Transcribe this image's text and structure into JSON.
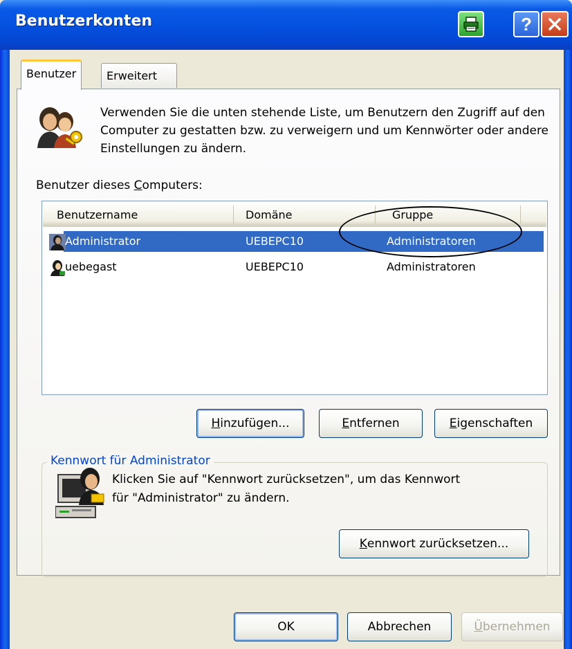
{
  "window": {
    "title": "Benutzerkonten",
    "icons": {
      "print": "printer-icon",
      "help": "help-icon",
      "close": "close-icon"
    },
    "help_glyph": "?"
  },
  "tabs": [
    {
      "label": "Benutzer",
      "active": true
    },
    {
      "label": "Erweitert",
      "active": false
    }
  ],
  "intro": {
    "icon": "users-key-icon",
    "text": "Verwenden Sie die unten stehende Liste, um Benutzern den Zugriff auf den Computer zu gestatten bzw. zu verweigern und um Kennwörter oder andere Einstellungen zu ändern."
  },
  "users_list": {
    "label_pre": "Benutzer dieses ",
    "label_accel": "C",
    "label_post": "omputers:",
    "columns": [
      "Benutzername",
      "Domäne",
      "Gruppe"
    ],
    "rows": [
      {
        "name": "Administrator",
        "domain": "UEBEPC10",
        "group": "Administratoren",
        "selected": true,
        "icon": "user-icon"
      },
      {
        "name": "uebegast",
        "domain": "UEBEPC10",
        "group": "Administratoren",
        "selected": false,
        "icon": "user-icon"
      }
    ]
  },
  "list_buttons": {
    "add": {
      "accel": "H",
      "rest": "inzufügen..."
    },
    "remove": {
      "accel": "E",
      "rest": "ntfernen"
    },
    "properties": {
      "accel": "E",
      "rest": "igenschaften"
    }
  },
  "password_group": {
    "title": "Kennwort für Administrator",
    "icon": "computer-user-icon",
    "line1": "Klicken Sie auf \"Kennwort zurücksetzen\", um das Kennwort",
    "line2": "für \"Administrator\" zu ändern.",
    "reset_button": {
      "accel": "K",
      "rest": "ennwort zurücksetzen..."
    }
  },
  "dialog_buttons": {
    "ok": "OK",
    "cancel": "Abbrechen",
    "apply": {
      "accel": "Ü",
      "rest": "bernehmen",
      "enabled": false
    }
  }
}
